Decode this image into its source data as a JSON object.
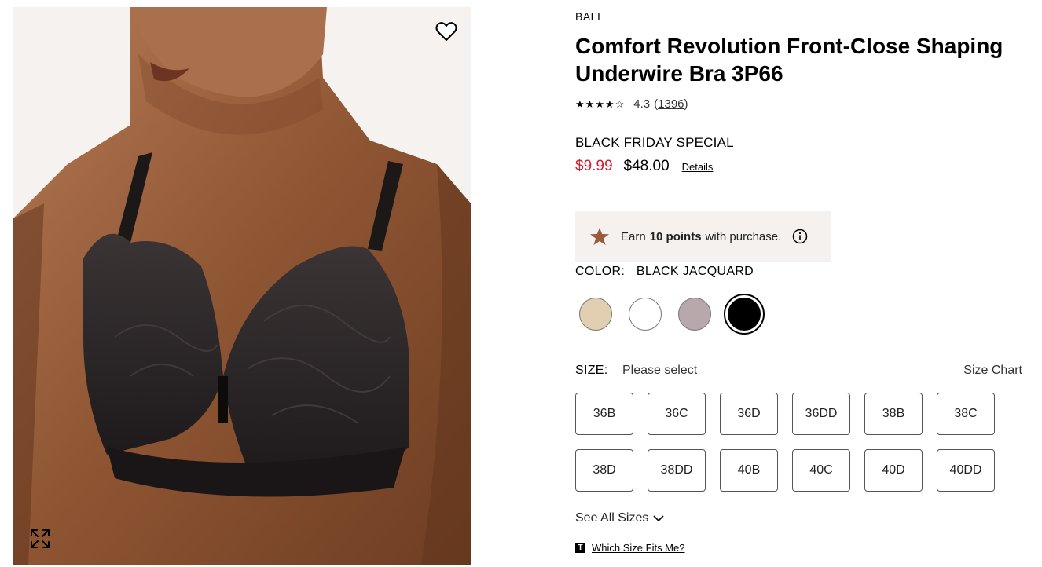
{
  "product": {
    "brand": "BALI",
    "title": "Comfort Revolution Front-Close Shaping Underwire Bra 3P66",
    "rating_value": "4.3",
    "rating_stars": 4.3,
    "review_count_open": "(",
    "review_count": "1396",
    "review_count_close": ")"
  },
  "pricing": {
    "promo_label": "BLACK FRIDAY SPECIAL",
    "sale_price": "$9.99",
    "original_price": "$48.00",
    "details_link": "Details",
    "sale_color": "#d12030"
  },
  "rewards": {
    "text_prefix": "Earn",
    "points": "10 points",
    "text_suffix": "with purchase.",
    "icon": "star-icon",
    "star_color": "#9c5a3c",
    "background": "#f5f1ee"
  },
  "color": {
    "label": "COLOR:",
    "selected": "BLACK JACQUARD",
    "swatches": [
      {
        "name": "nude",
        "hex": "#e2cfb2",
        "selected": false
      },
      {
        "name": "white",
        "hex": "#ffffff",
        "selected": false
      },
      {
        "name": "mauve",
        "hex": "#b8a7ab",
        "selected": false
      },
      {
        "name": "black",
        "hex": "#000000",
        "selected": true
      }
    ]
  },
  "size": {
    "label": "SIZE:",
    "value": "Please select",
    "chart_link": "Size Chart",
    "options": [
      "36B",
      "36C",
      "36D",
      "36DD",
      "38B",
      "38C",
      "38D",
      "38DD",
      "40B",
      "40C",
      "40D",
      "40DD"
    ],
    "see_all": "See All Sizes",
    "fit_badge": "T",
    "fit_link": "Which Size Fits Me?"
  },
  "image": {
    "wishlist_icon": "heart-icon",
    "zoom_icon": "expand-icon"
  }
}
